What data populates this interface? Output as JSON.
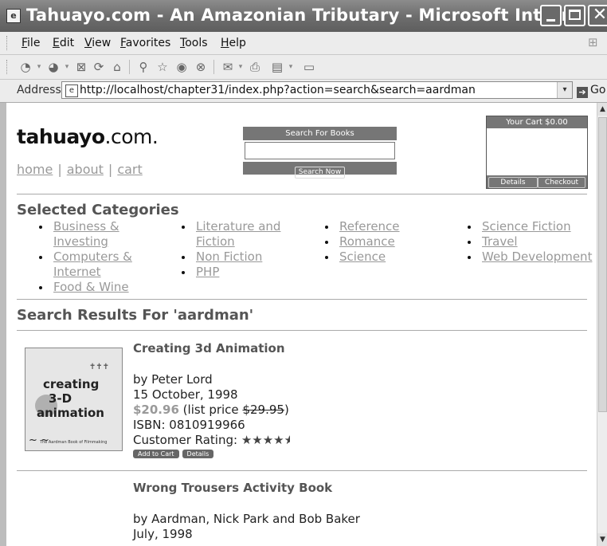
{
  "window": {
    "title": "Tahuayo.com - An Amazonian Tributary - Microsoft Intern...",
    "app_icon": "ie-page-icon"
  },
  "menu": [
    "File",
    "Edit",
    "View",
    "Favorites",
    "Tools",
    "Help"
  ],
  "toolbar_icons": [
    "back-icon",
    "forward-icon",
    "stop-icon",
    "refresh-icon",
    "home-icon",
    "search-icon",
    "favorites-icon",
    "media-icon",
    "history-icon",
    "mail-icon",
    "print-icon",
    "edit-icon",
    "discuss-icon"
  ],
  "address": {
    "label": "Address",
    "url": "http://localhost/chapter31/index.php?action=search&search=aardman",
    "go_label": "Go"
  },
  "site": {
    "logo_bold": "tahuayo",
    "logo_rest": ".com.",
    "nav": {
      "home": "home",
      "about": "about",
      "cart": "cart",
      "sep": "|"
    },
    "search": {
      "header": "Search For Books",
      "value": "",
      "button": "Search Now"
    },
    "cart": {
      "header": "Your Cart $0.00",
      "details": "Details",
      "checkout": "Checkout"
    }
  },
  "categories": {
    "title": "Selected Categories",
    "columns": [
      [
        "Business & Investing",
        "Computers & Internet",
        "Food & Wine"
      ],
      [
        "Literature and Fiction",
        "Non Fiction",
        "PHP"
      ],
      [
        "Reference",
        "Romance",
        "Science"
      ],
      [
        "Science Fiction",
        "Travel",
        "Web Development"
      ]
    ]
  },
  "results": {
    "title": "Search Results For 'aardman'",
    "books": [
      {
        "title": "Creating 3d Animation",
        "author": "by Peter Lord",
        "date": "15 October, 1998",
        "price": "$20.96",
        "list_prefix": "(list price",
        "list_price": "$29.95",
        "list_suffix": ")",
        "isbn": "ISBN: 0810919966",
        "rating_label": "Customer Rating:",
        "rating": 4.5,
        "rating_stars": "★★★★★",
        "add_to_cart": "Add to Cart",
        "details": "Details",
        "cover": {
          "line1": "creating",
          "line2": "3-D",
          "line3": "animation",
          "caption": "The Aardman Book of Filmmaking"
        }
      },
      {
        "title": "Wrong Trousers Activity Book",
        "author": "by Aardman, Nick Park and Bob Baker",
        "date": "July, 1998"
      }
    ]
  }
}
